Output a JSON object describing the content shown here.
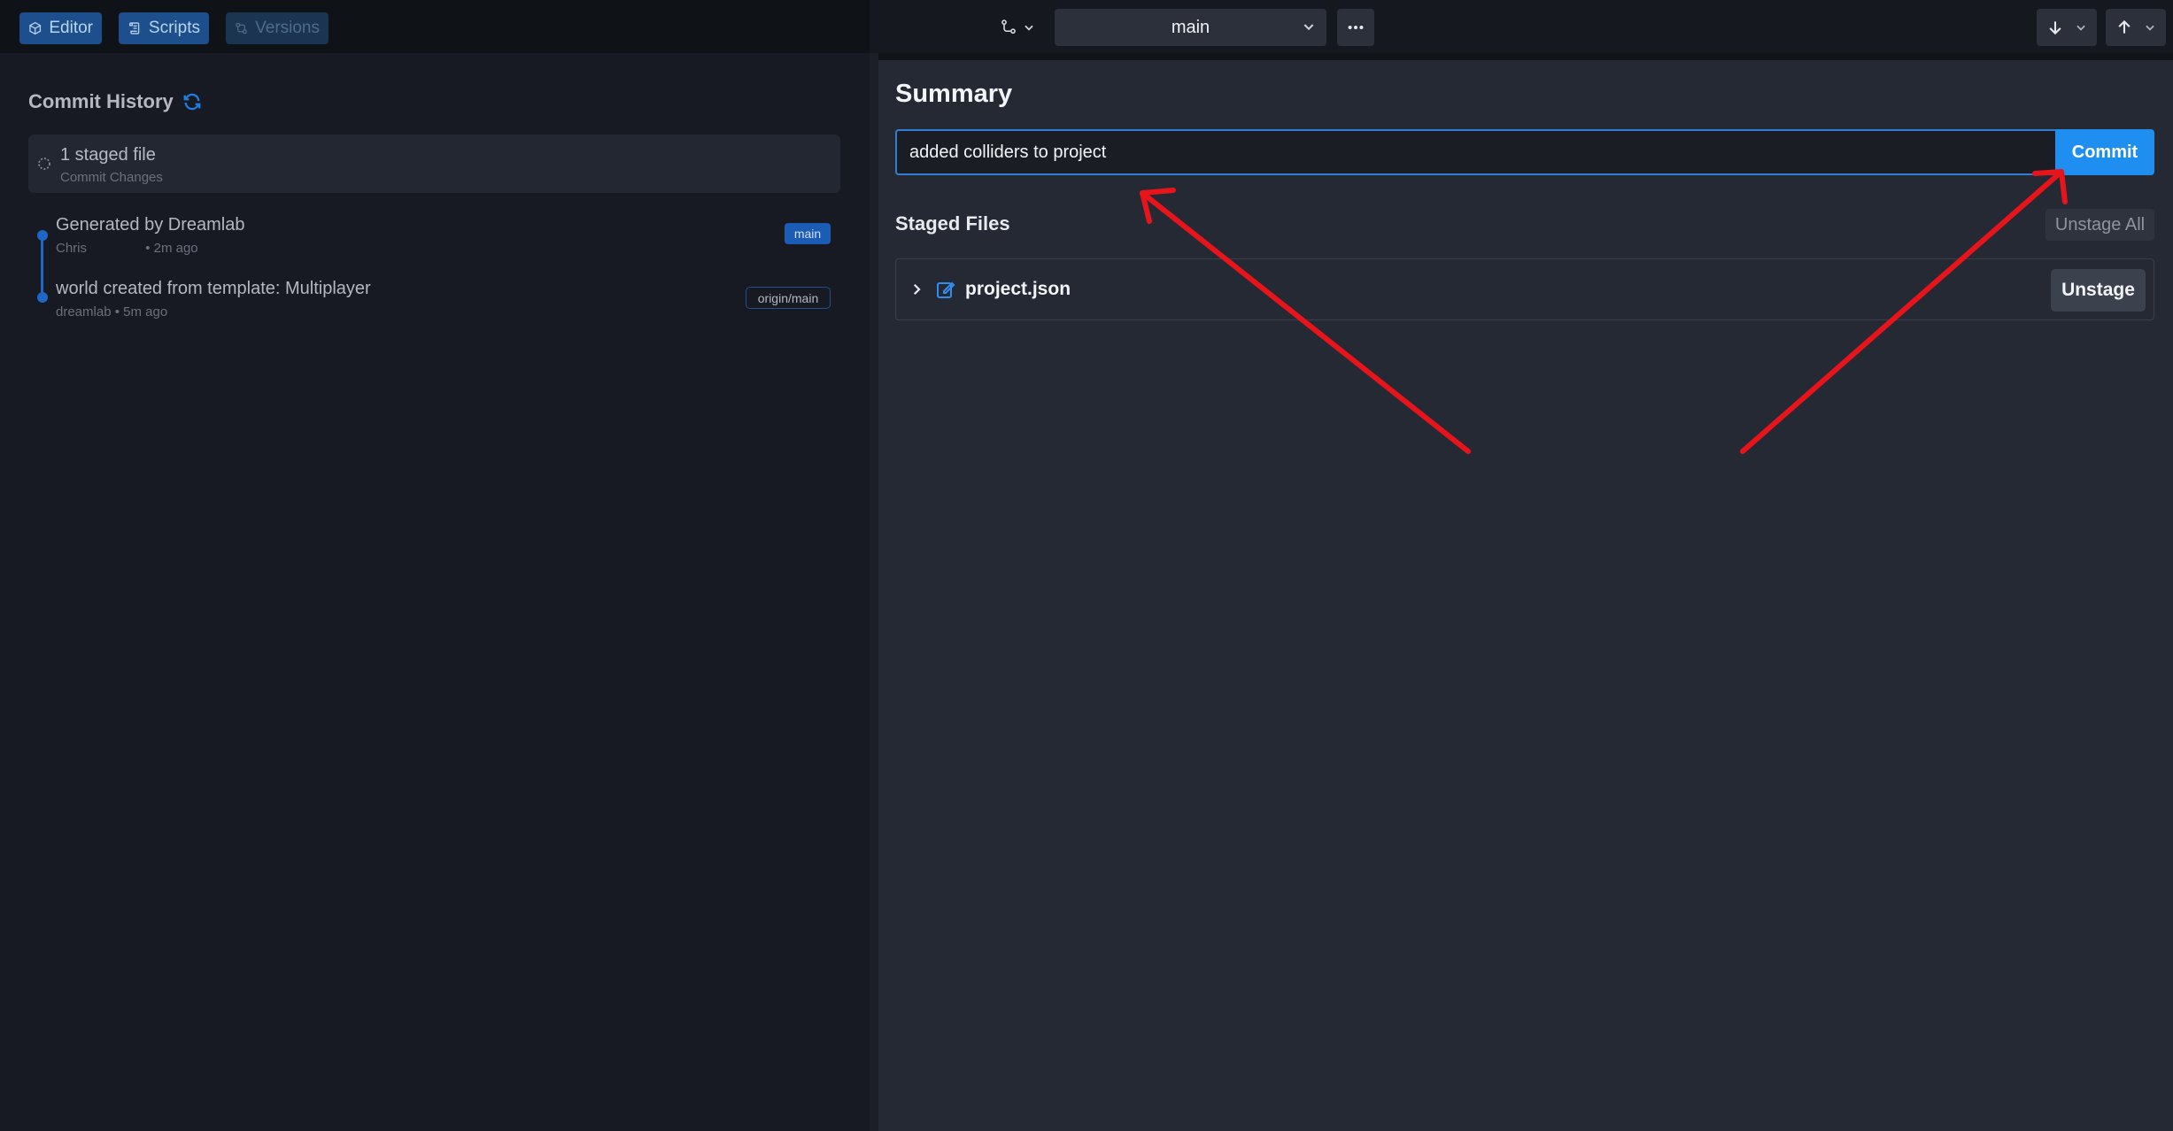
{
  "toolbar": {
    "modes": [
      {
        "label": "Editor",
        "icon": "cube-icon"
      },
      {
        "label": "Scripts",
        "icon": "scroll-icon"
      },
      {
        "label": "Versions",
        "icon": "git-compare-icon"
      }
    ],
    "branch": {
      "current": "main"
    },
    "icons": [
      "git-branch-icon",
      "chevron-down-icon",
      "more-horizontal-icon",
      "arrow-down-icon",
      "arrow-up-icon"
    ]
  },
  "history": {
    "title": "Commit History",
    "staged": {
      "title": "1 staged file",
      "subtitle": "Commit Changes"
    },
    "commits": [
      {
        "title": "Generated by Dreamlab",
        "author": "Chris",
        "time": "• 2m ago",
        "tag": "main"
      },
      {
        "title": "world created from template: Multiplayer",
        "author": "dreamlab",
        "time": "• 5m ago",
        "tag": "origin/main"
      }
    ]
  },
  "summary": {
    "title": "Summary",
    "input_value": "added colliders to project",
    "commit_label": "Commit"
  },
  "staged_files": {
    "title": "Staged Files",
    "unstage_all_label": "Unstage All",
    "files": [
      {
        "name": "project.json",
        "action": "Unstage"
      }
    ]
  },
  "colors": {
    "accent": "#1f8ef1",
    "annotation": "#e8141b",
    "panel": "#252934",
    "sidebar": "#171a22"
  }
}
